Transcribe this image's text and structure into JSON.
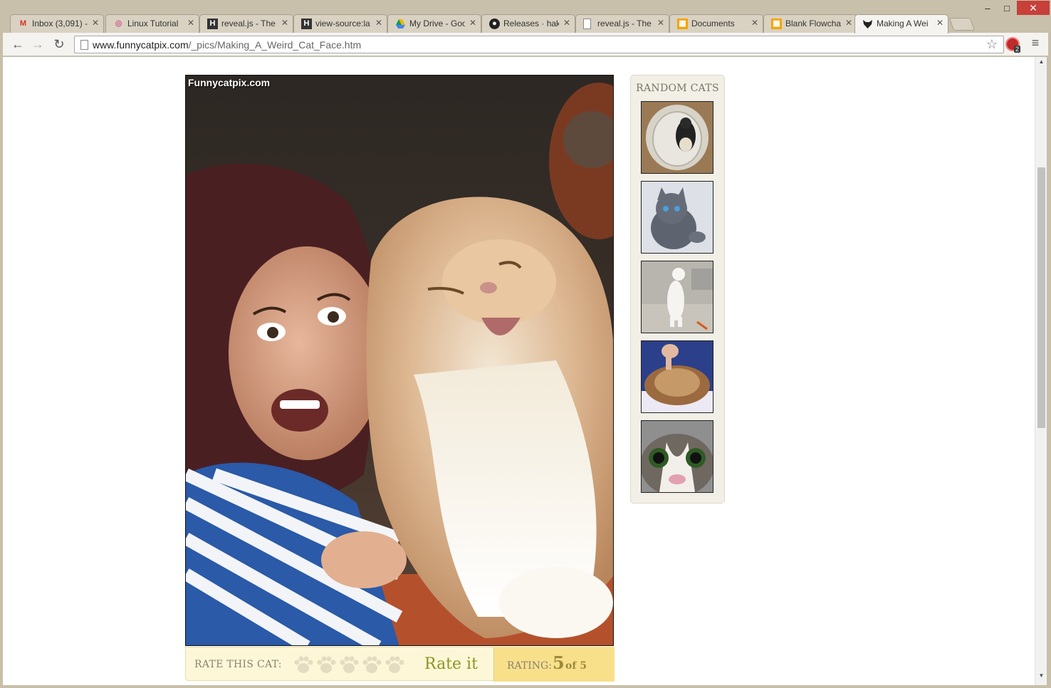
{
  "browser": {
    "tabs": [
      {
        "label": "Inbox (3,091) -",
        "icon": "gmail-icon",
        "active": false
      },
      {
        "label": "Linux Tutorial",
        "icon": "swirl-icon",
        "active": false
      },
      {
        "label": "reveal.js - The",
        "icon": "h-icon",
        "active": false
      },
      {
        "label": "view-source:la",
        "icon": "h-icon",
        "active": false
      },
      {
        "label": "My Drive - Goo",
        "icon": "drive-icon",
        "active": false
      },
      {
        "label": "Releases · haki",
        "icon": "github-icon",
        "active": false
      },
      {
        "label": "reveal.js - The",
        "icon": "page-icon",
        "active": false
      },
      {
        "label": "Documents",
        "icon": "grid-icon",
        "active": false
      },
      {
        "label": "Blank Flowcha",
        "icon": "grid-icon",
        "active": false
      },
      {
        "label": "Making A Wei",
        "icon": "cat-icon",
        "active": true
      }
    ],
    "url_host": "www.funnycatpix.com",
    "url_path": "/_pics/Making_A_Weird_Cat_Face.htm",
    "extension_badge": "2",
    "window_buttons": {
      "minimize": "–",
      "maximize": "□",
      "close": "✕"
    }
  },
  "page": {
    "photo_watermark": "Funnycatpix.com",
    "rate_label": "RATE THIS CAT:",
    "rate_it": "Rate it",
    "rating_label": "RATING:",
    "rating_value": "5",
    "rating_of": "of 5",
    "rating_fraction": 1.0,
    "sidebar_title": "RANDOM CATS",
    "random_cats": [
      {
        "name": "cat-in-hamper"
      },
      {
        "name": "grey-kitten"
      },
      {
        "name": "standing-white-cat"
      },
      {
        "name": "fluffy-brown-cat"
      },
      {
        "name": "wide-eyed-cat"
      }
    ]
  }
}
